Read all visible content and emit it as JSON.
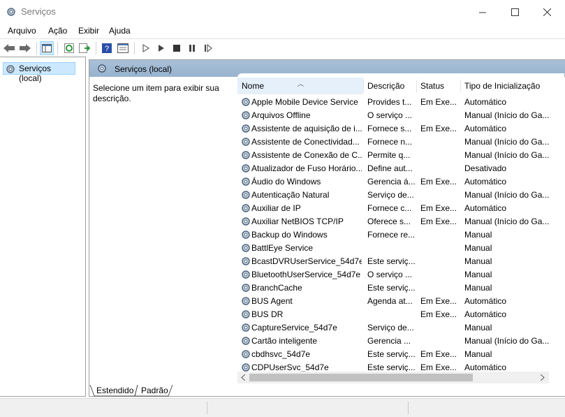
{
  "window": {
    "title": "Serviços",
    "title_icon": "services-gear-icon"
  },
  "menu": [
    "Arquivo",
    "Ação",
    "Exibir",
    "Ajuda"
  ],
  "toolbar": [
    "back-arrow-icon",
    "forward-arrow-icon",
    "show-hide-tree-icon",
    "refresh-icon",
    "export-list-icon",
    "help-icon",
    "properties-icon",
    "start-service-icon",
    "start-service-alt-icon",
    "stop-service-icon",
    "pause-service-icon",
    "resume-service-icon"
  ],
  "tree": {
    "item_label": "Serviços (local)"
  },
  "panel": {
    "header_label": "Serviços (local)",
    "description": "Selecione um item para exibir sua descrição."
  },
  "table": {
    "columns": [
      "Nome",
      "Descrição",
      "Status",
      "Tipo de Inicialização"
    ],
    "rows": [
      [
        "Apple Mobile Device Service",
        "Provides t...",
        "Em Exe...",
        "Automático"
      ],
      [
        "Arquivos Offline",
        "O serviço ...",
        "",
        "Manual (Início do Ga..."
      ],
      [
        "Assistente de aquisição de i...",
        "Fornece s...",
        "Em Exe...",
        "Automático"
      ],
      [
        "Assistente de Conectividad...",
        "Fornece n...",
        "",
        "Manual (Início do Ga..."
      ],
      [
        "Assistente de Conexão de C...",
        "Permite q...",
        "",
        "Manual (Início do Ga..."
      ],
      [
        "Atualizador de Fuso Horário...",
        "Define aut...",
        "",
        "Desativado"
      ],
      [
        "Áudio do Windows",
        "Gerencia á...",
        "Em Exe...",
        "Automático"
      ],
      [
        "Autenticação Natural",
        "Serviço de...",
        "",
        "Manual (Início do Ga..."
      ],
      [
        "Auxiliar de IP",
        "Fornece c...",
        "Em Exe...",
        "Automático"
      ],
      [
        "Auxiliar NetBIOS TCP/IP",
        "Oferece s...",
        "Em Exe...",
        "Manual (Início do Ga..."
      ],
      [
        "Backup do Windows",
        "Fornece re...",
        "",
        "Manual"
      ],
      [
        "BattlEye Service",
        "",
        "",
        "Manual"
      ],
      [
        "BcastDVRUserService_54d7e",
        "Este serviç...",
        "",
        "Manual"
      ],
      [
        "BluetoothUserService_54d7e",
        "O serviço ...",
        "",
        "Manual"
      ],
      [
        "BranchCache",
        "Este serviç...",
        "",
        "Manual"
      ],
      [
        "BUS Agent",
        "Agenda at...",
        "Em Exe...",
        "Automático"
      ],
      [
        "BUS DR",
        "",
        "Em Exe...",
        "Automático"
      ],
      [
        "CaptureService_54d7e",
        "Serviço de...",
        "",
        "Manual"
      ],
      [
        "Cartão inteligente",
        "Gerencia ...",
        "",
        "Manual (Início do Ga..."
      ],
      [
        "cbdhsvc_54d7e",
        "Este serviç...",
        "Em Exe...",
        "Manual"
      ],
      [
        "CDPUserSvc_54d7e",
        "Este serviç...",
        "Em Exe...",
        "Automático"
      ]
    ]
  },
  "tabs": {
    "extended": "Estendido",
    "standard": "Padrão"
  }
}
